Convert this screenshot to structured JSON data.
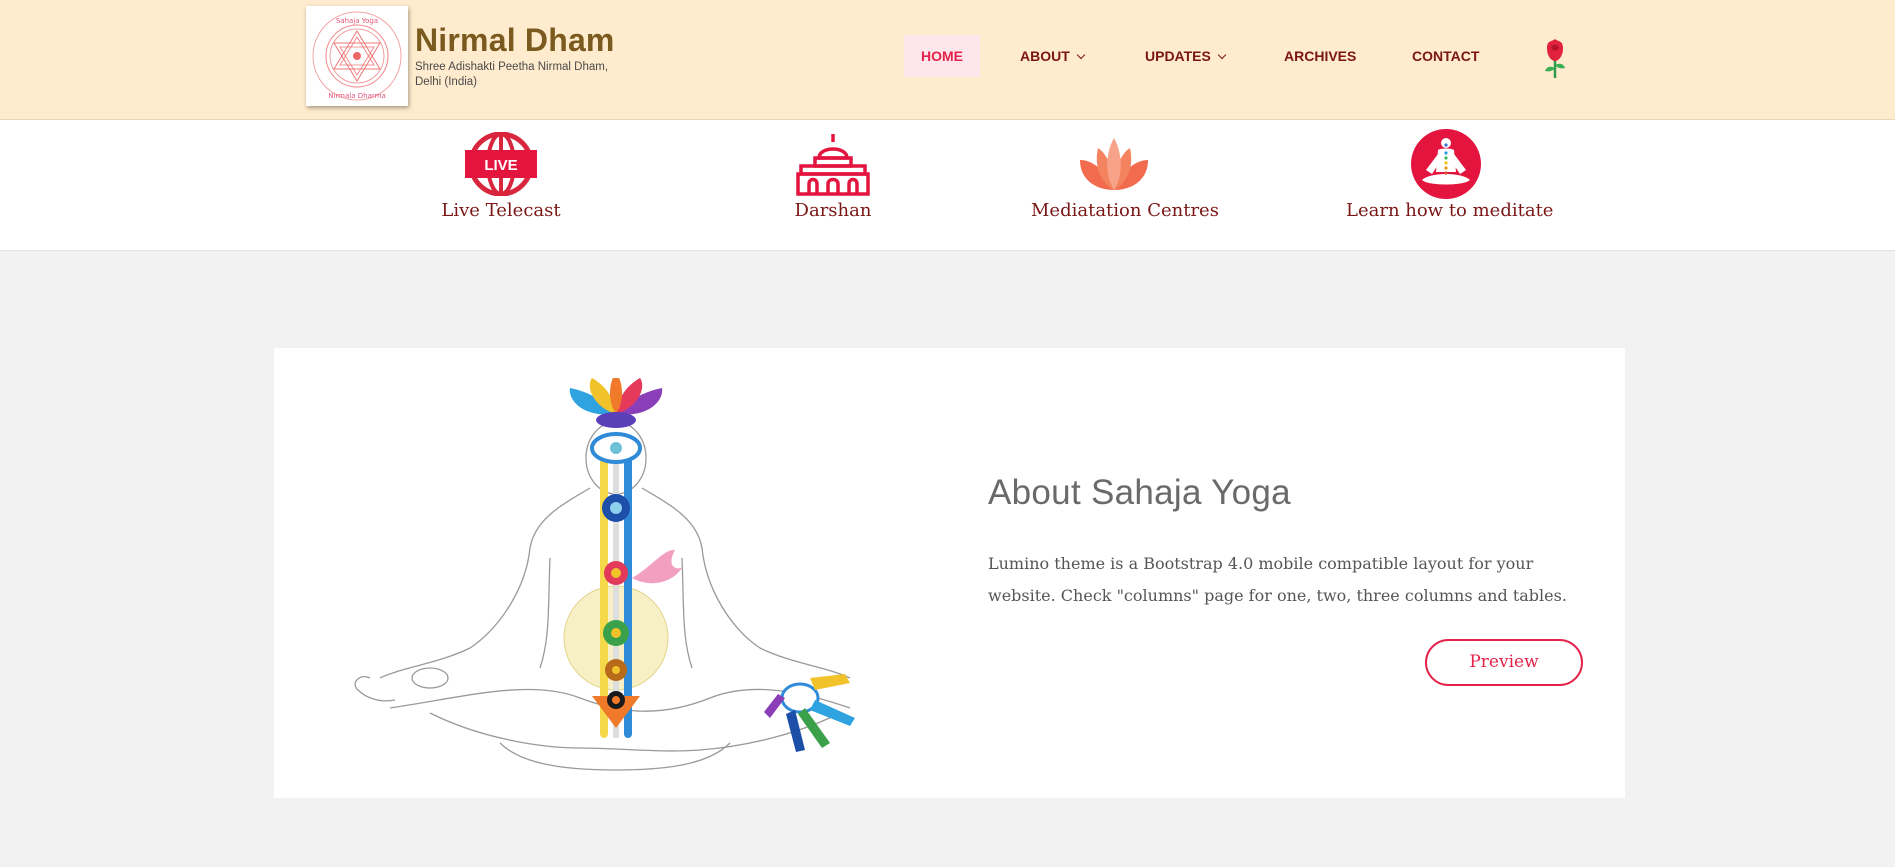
{
  "brand": {
    "title": "Nirmal Dham",
    "subtitle": "Shree Adishakti Peetha Nirmal Dham, Delhi (India)",
    "logo_ring_text": "Sahaja Yoga International · Vishwa Nirmala Dharma",
    "logo_icon": "sri-yantra-icon"
  },
  "nav": {
    "items": [
      {
        "label": "HOME",
        "active": true
      },
      {
        "label": "ABOUT",
        "has_dropdown": true
      },
      {
        "label": "UPDATES",
        "has_dropdown": true
      },
      {
        "label": "ARCHIVES"
      },
      {
        "label": "CONTACT"
      }
    ],
    "extra_icon": "rose-icon"
  },
  "quick_links": [
    {
      "label": "Live Telecast",
      "icon": "live-globe-icon",
      "badge": "LIVE"
    },
    {
      "label": "Darshan",
      "icon": "temple-icon"
    },
    {
      "label": "Mediatation Centres",
      "icon": "lotus-icon"
    },
    {
      "label": "Learn how to meditate",
      "icon": "meditation-icon"
    }
  ],
  "about": {
    "title": "About Sahaja Yoga",
    "text": "Lumino theme is a Bootstrap 4.0 mobile compatible layout for your website. Check \"columns\" page for one, two, three columns and tables.",
    "button_label": "Preview",
    "image": "chakra-meditation-figure"
  },
  "colors": {
    "header_bg": "#ffebcd",
    "accent": "#e3234a",
    "nav_text": "#7a1616",
    "brand_title": "#7a5a1e",
    "page_bg": "#f2f2f2"
  }
}
